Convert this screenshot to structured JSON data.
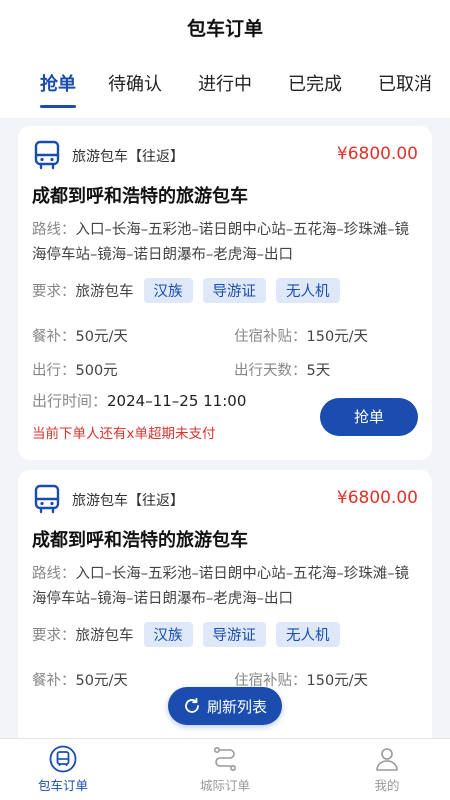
{
  "header": {
    "title": "包车订单",
    "tabs": [
      {
        "label": "抢单",
        "active": true
      },
      {
        "label": "待确认",
        "active": false
      },
      {
        "label": "进行中",
        "active": false
      },
      {
        "label": "已完成",
        "active": false
      },
      {
        "label": "已取消",
        "active": false
      }
    ]
  },
  "orders": [
    {
      "type_label": "旅游包车【往返】",
      "price": "¥6800.00",
      "title": "成都到呼和浩特的旅游包车",
      "route_key": "路线：",
      "route": "入口–长海–五彩池–诺日朗中心站–五花海–珍珠滩–镜海停车站–镜海–诺日朗瀑布–老虎海–出口",
      "req_key": "要求：",
      "req_value": "旅游包车",
      "tags": [
        "汉族",
        "导游证",
        "无人机"
      ],
      "meal_key": "餐补：",
      "meal_value": "50元/天",
      "lodging_key": "住宿补贴：",
      "lodging_value": "150元/天",
      "trip_key": "出行：",
      "trip_value": "500元",
      "days_key": "出行天数：",
      "days_value": "5天",
      "time_key": "出行时间：",
      "time_value": "2024–11–25 11:00",
      "warning": "当前下单人还有x单超期未支付",
      "action_label": "抢单"
    },
    {
      "type_label": "旅游包车【往返】",
      "price": "¥6800.00",
      "title": "成都到呼和浩特的旅游包车",
      "route_key": "路线：",
      "route": "入口–长海–五彩池–诺日朗中心站–五花海–珍珠滩–镜海停车站–镜海–诺日朗瀑布–老虎海–出口",
      "req_key": "要求：",
      "req_value": "旅游包车",
      "tags": [
        "汉族",
        "导游证",
        "无人机"
      ],
      "meal_key": "餐补：",
      "meal_value": "50元/天",
      "lodging_key": "住宿补贴：",
      "lodging_value": "150元/天"
    }
  ],
  "refresh_label": "刷新列表",
  "tabbar": [
    {
      "label": "包车订单",
      "icon": "bus-icon",
      "active": true
    },
    {
      "label": "城际订单",
      "icon": "route-icon",
      "active": false
    },
    {
      "label": "我的",
      "icon": "person-icon",
      "active": false
    }
  ],
  "colors": {
    "accent": "#1a4dae",
    "price": "#e0322b",
    "tag_bg": "#dfe8f8"
  }
}
